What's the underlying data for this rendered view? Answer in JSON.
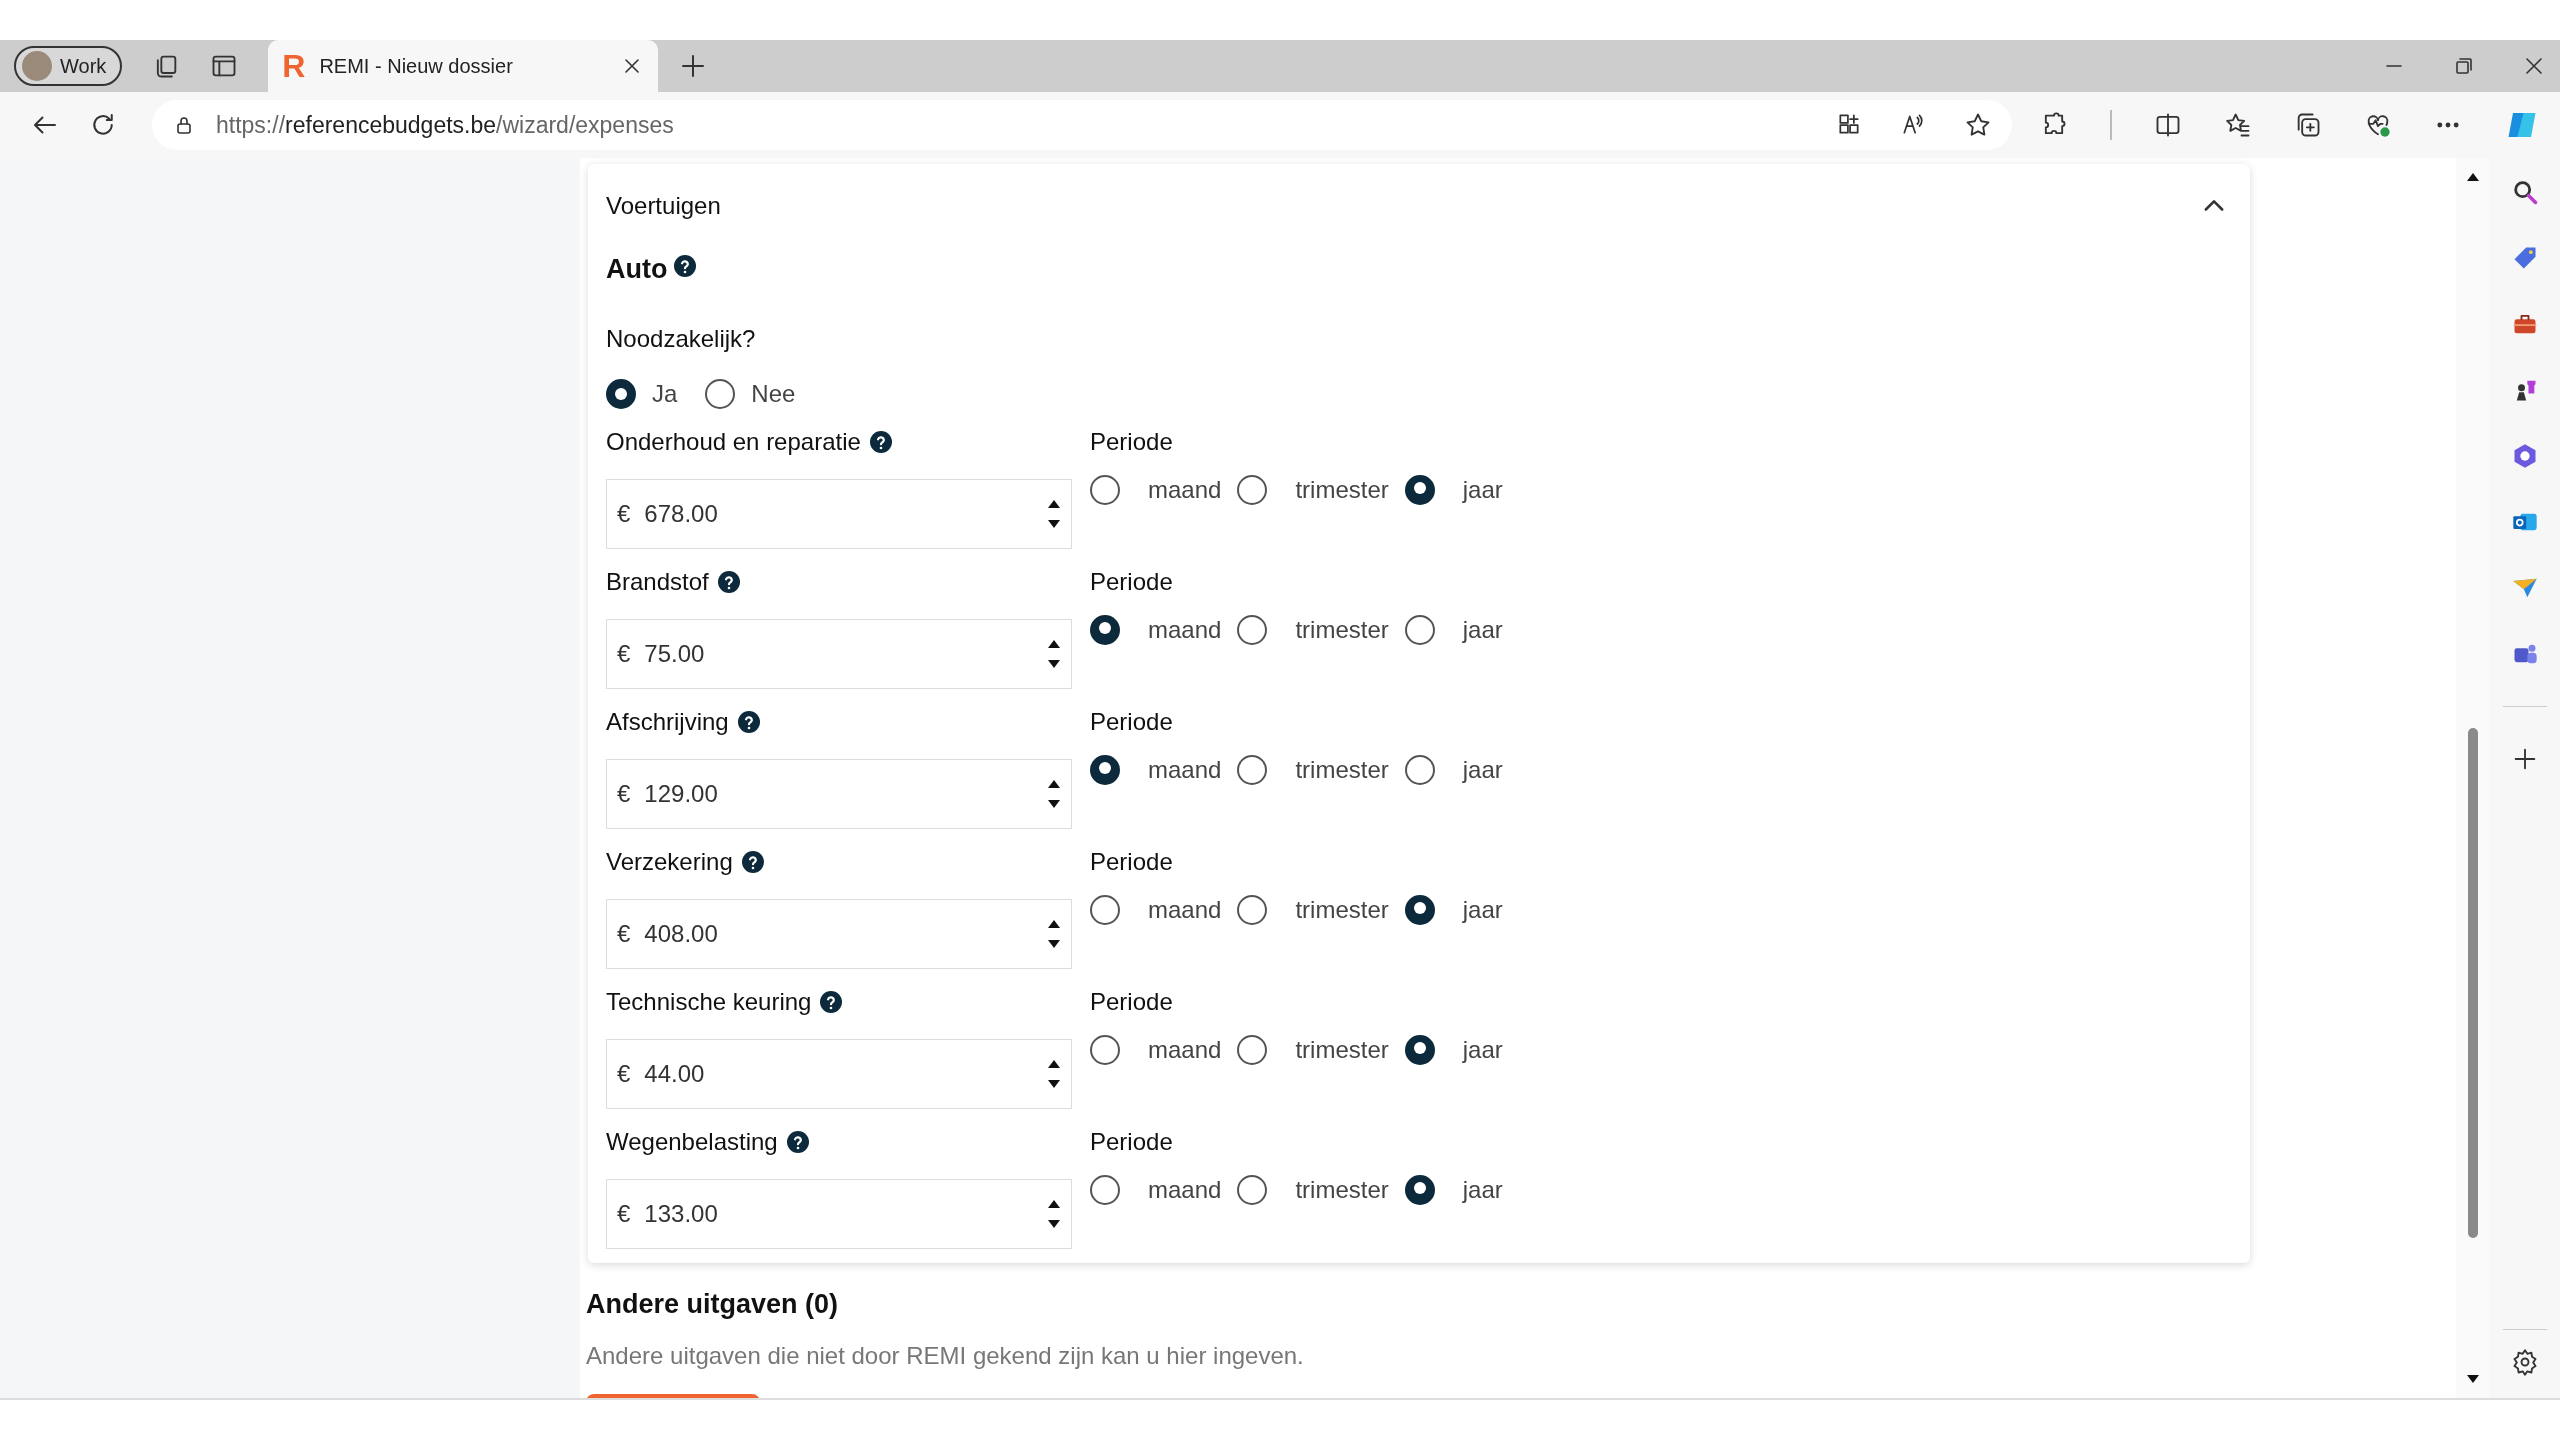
{
  "browser": {
    "profile": "Work",
    "tab": {
      "logo": "R",
      "title": "REMI - Nieuw dossier"
    },
    "url": {
      "scheme": "https://",
      "host": "referencebudgets.be",
      "path": "/wizard/expenses"
    }
  },
  "section": {
    "title": "Voertuigen",
    "expanded": true,
    "subtitle": "Auto",
    "question": {
      "label": "Noodzakelijk?",
      "options": [
        {
          "label": "Ja",
          "selected": true
        },
        {
          "label": "Nee",
          "selected": false
        }
      ]
    },
    "expenses": [
      {
        "label": "Onderhoud en reparatie",
        "currency": "€",
        "value": "678.00",
        "period_label": "Periode",
        "periods": [
          {
            "label": "maand",
            "selected": false
          },
          {
            "label": "trimester",
            "selected": false
          },
          {
            "label": "jaar",
            "selected": true
          }
        ]
      },
      {
        "label": "Brandstof",
        "currency": "€",
        "value": "75.00",
        "period_label": "Periode",
        "periods": [
          {
            "label": "maand",
            "selected": true
          },
          {
            "label": "trimester",
            "selected": false
          },
          {
            "label": "jaar",
            "selected": false
          }
        ]
      },
      {
        "label": "Afschrijving",
        "currency": "€",
        "value": "129.00",
        "period_label": "Periode",
        "periods": [
          {
            "label": "maand",
            "selected": true
          },
          {
            "label": "trimester",
            "selected": false
          },
          {
            "label": "jaar",
            "selected": false
          }
        ]
      },
      {
        "label": "Verzekering",
        "currency": "€",
        "value": "408.00",
        "period_label": "Periode",
        "periods": [
          {
            "label": "maand",
            "selected": false
          },
          {
            "label": "trimester",
            "selected": false
          },
          {
            "label": "jaar",
            "selected": true
          }
        ]
      },
      {
        "label": "Technische keuring",
        "currency": "€",
        "value": "44.00",
        "period_label": "Periode",
        "periods": [
          {
            "label": "maand",
            "selected": false
          },
          {
            "label": "trimester",
            "selected": false
          },
          {
            "label": "jaar",
            "selected": true
          }
        ]
      },
      {
        "label": "Wegenbelasting",
        "currency": "€",
        "value": "133.00",
        "period_label": "Periode",
        "periods": [
          {
            "label": "maand",
            "selected": false
          },
          {
            "label": "trimester",
            "selected": false
          },
          {
            "label": "jaar",
            "selected": true
          }
        ]
      }
    ]
  },
  "other": {
    "title": "Andere uitgaven (0)",
    "text": "Andere uitgaven die niet door REMI gekend zijn kan u hier ingeven."
  }
}
